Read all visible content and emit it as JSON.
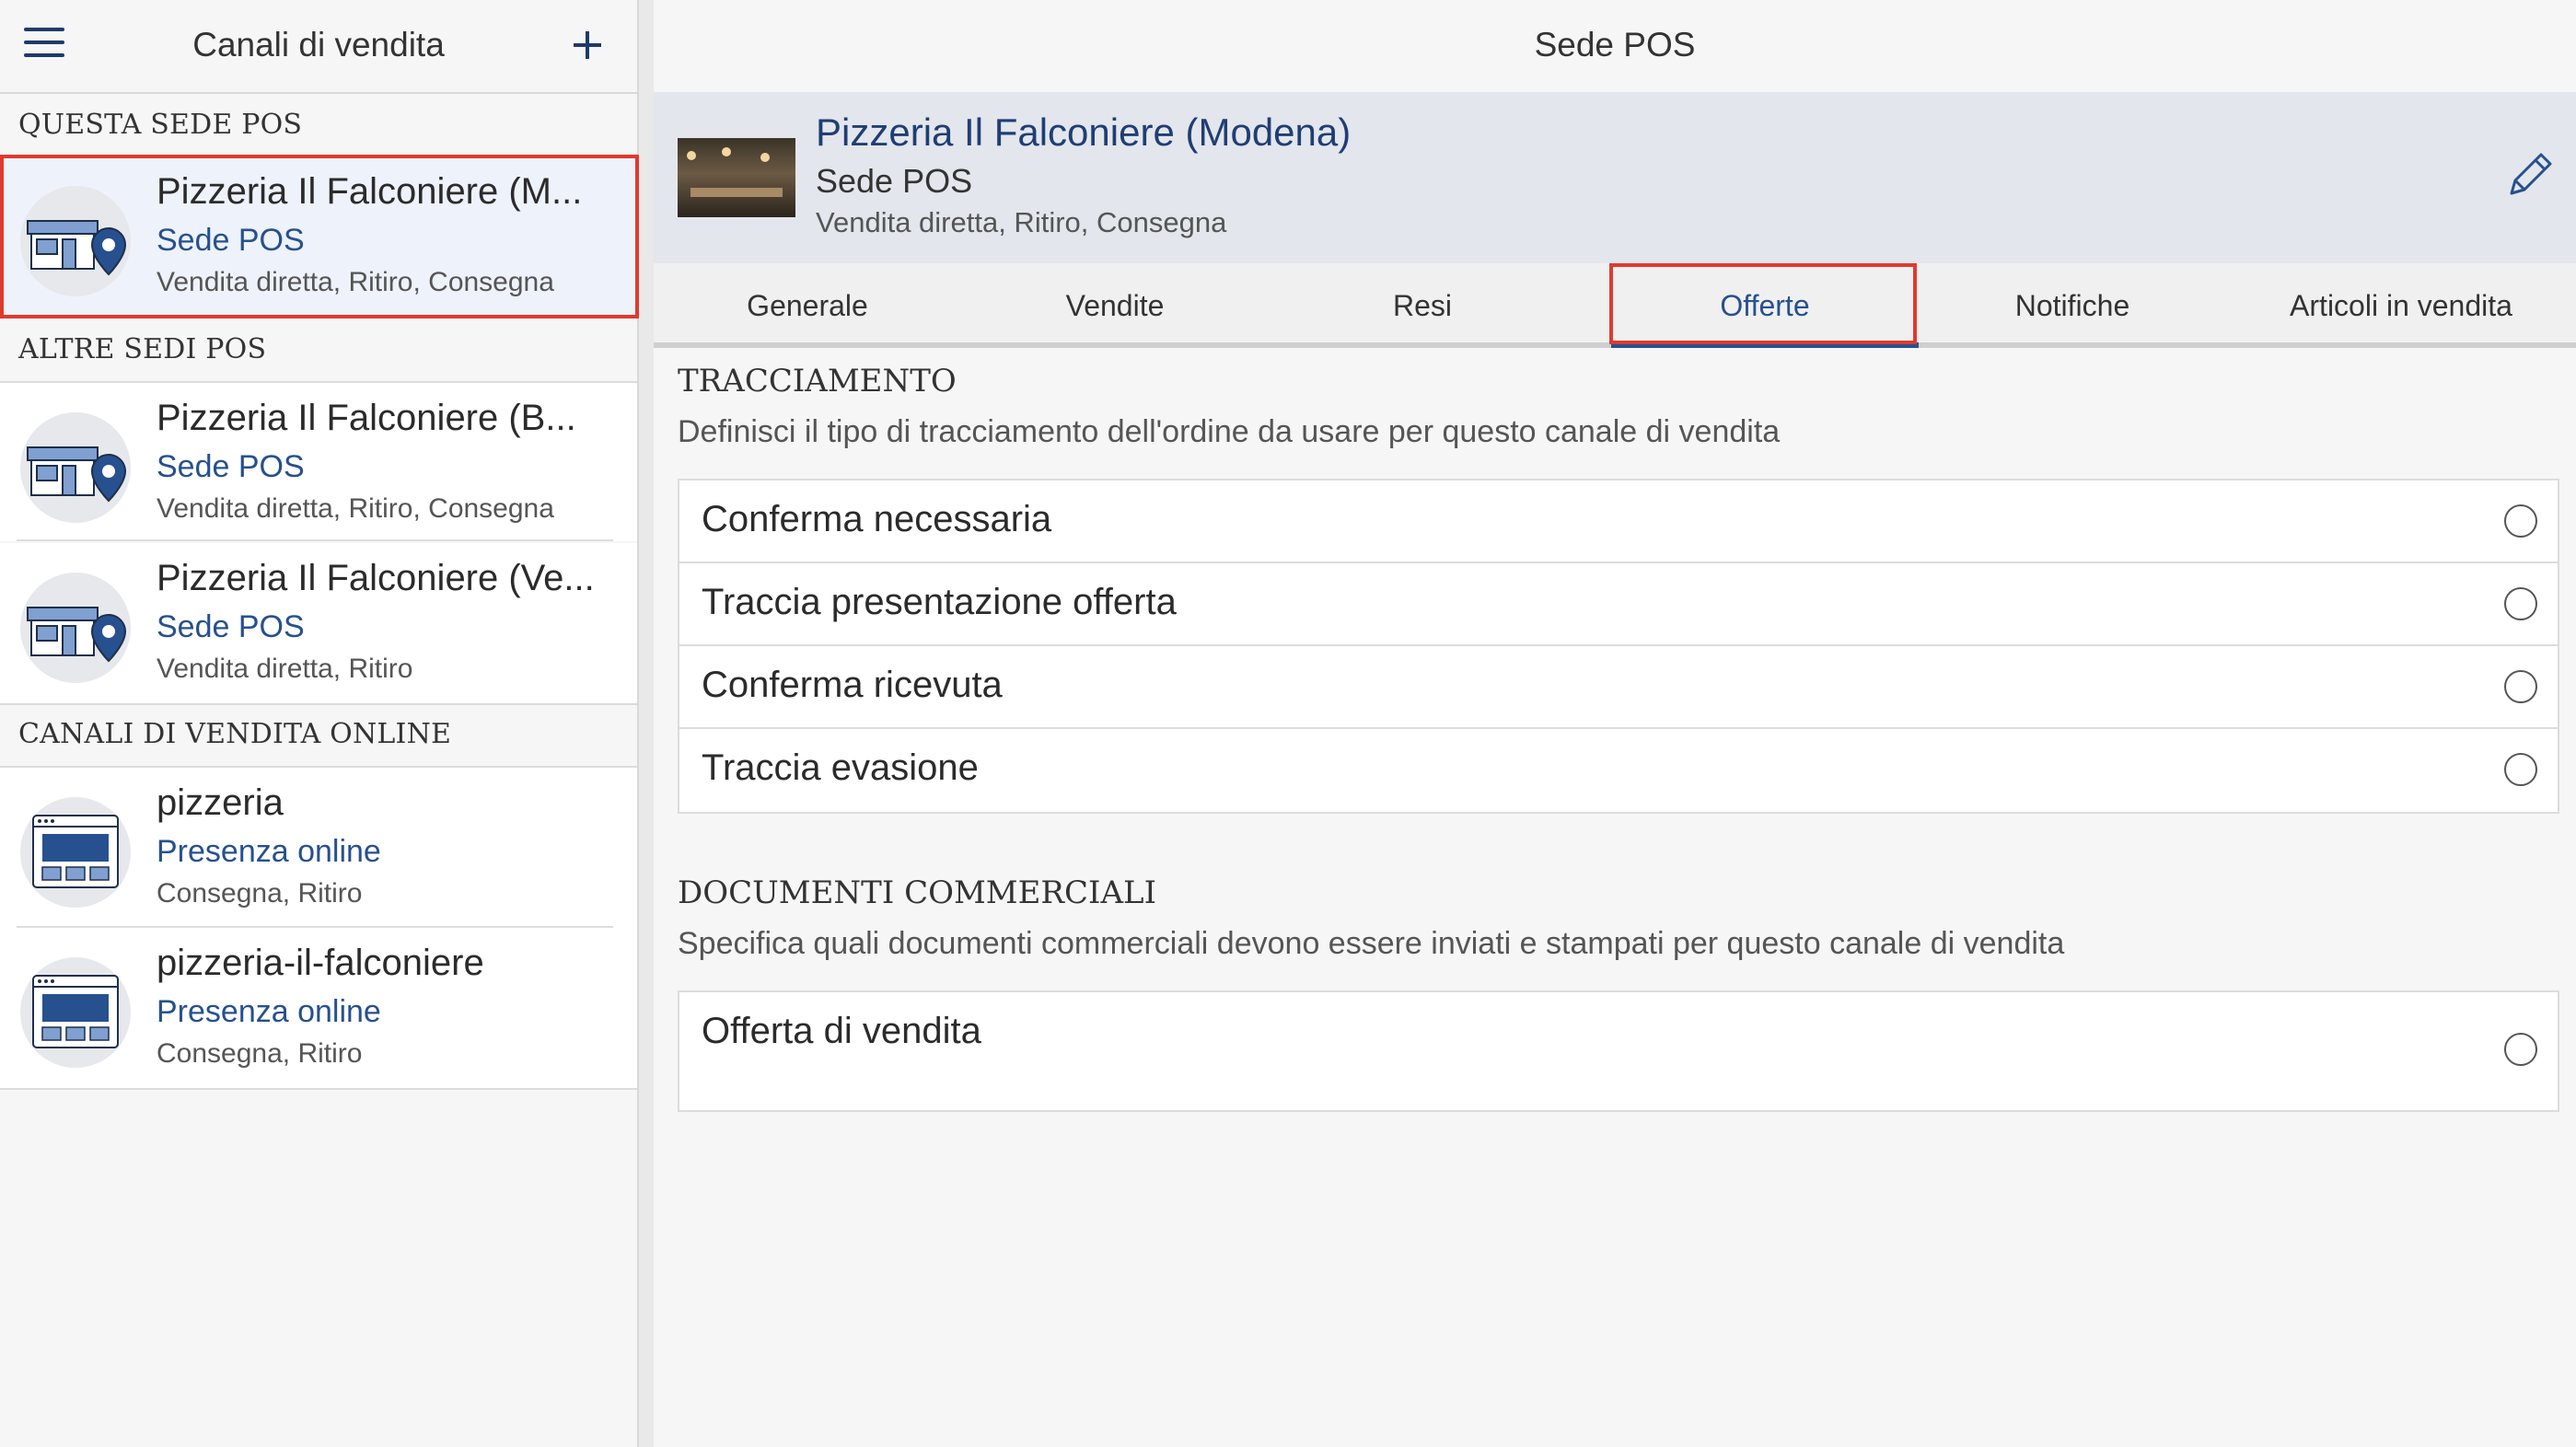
{
  "left_panel": {
    "title": "Canali di vendita",
    "sections": {
      "this": "QUESTA SEDE POS",
      "others": "ALTRE SEDI POS",
      "online": "CANALI DI VENDITA ONLINE"
    },
    "items": [
      {
        "name": "Pizzeria Il Falconiere (M...",
        "type": "Sede POS",
        "desc": "Vendita diretta, Ritiro, Consegna",
        "icon": "store-location-icon",
        "selected": true
      },
      {
        "name": "Pizzeria Il Falconiere (B...",
        "type": "Sede POS",
        "desc": "Vendita diretta, Ritiro, Consegna",
        "icon": "store-location-icon"
      },
      {
        "name": "Pizzeria Il Falconiere (Ve...",
        "type": "Sede POS",
        "desc": "Vendita diretta, Ritiro",
        "icon": "store-location-icon"
      },
      {
        "name": "pizzeria",
        "type": "Presenza online",
        "desc": "Consegna, Ritiro",
        "icon": "browser-window-icon"
      },
      {
        "name": "pizzeria-il-falconiere",
        "type": "Presenza online",
        "desc": "Consegna, Ritiro",
        "icon": "browser-window-icon"
      }
    ]
  },
  "right_panel": {
    "title": "Sede POS",
    "location": {
      "name": "Pizzeria Il Falconiere (Modena)",
      "type": "Sede POS",
      "desc": "Vendita diretta, Ritiro, Consegna"
    },
    "tabs": [
      "Generale",
      "Vendite",
      "Resi",
      "Offerte",
      "Notifiche",
      "Articoli in vendita"
    ],
    "active_tab": "Offerte",
    "tracking": {
      "title": "TRACCIAMENTO",
      "desc": "Definisci il tipo di tracciamento dell'ordine da usare per questo canale di vendita",
      "options": [
        "Conferma necessaria",
        "Traccia presentazione offerta",
        "Conferma ricevuta",
        "Traccia evasione"
      ]
    },
    "documents": {
      "title": "DOCUMENTI COMMERCIALI",
      "desc": "Specifica quali documenti commerciali devono essere inviati e stampati per questo canale di vendita",
      "options": [
        "Offerta di vendita"
      ]
    }
  },
  "colors": {
    "accent": "#27508f",
    "highlight": "#e03a2e",
    "selected_bg": "#eef2fa"
  }
}
